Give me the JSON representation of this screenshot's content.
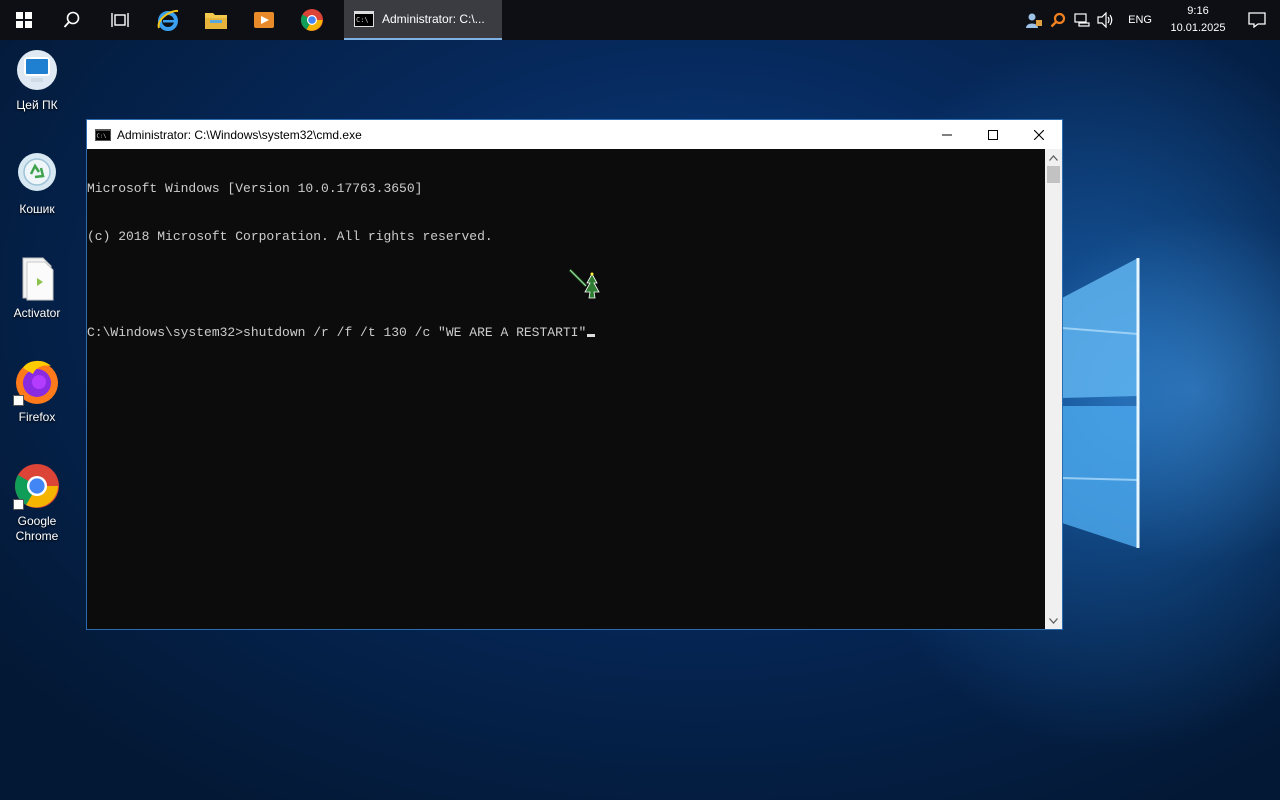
{
  "taskbar": {
    "start_icon": "windows-logo-icon",
    "pinned": [
      {
        "name": "search-icon"
      },
      {
        "name": "task-view-icon"
      },
      {
        "name": "internet-explorer-icon"
      },
      {
        "name": "file-explorer-icon"
      },
      {
        "name": "media-player-icon"
      },
      {
        "name": "chrome-icon"
      }
    ],
    "active_app_label": "Administrator: C:\\...",
    "tray": {
      "language": "ENG",
      "time": "9:16",
      "date": "10.01.2025"
    }
  },
  "desktop": {
    "icons": [
      {
        "label": "Цей ПК",
        "icon": "computer-icon"
      },
      {
        "label": "Кошик",
        "icon": "recycle-bin-icon"
      },
      {
        "label": "Activator",
        "icon": "file-icon"
      },
      {
        "label": "Firefox",
        "icon": "firefox-icon"
      },
      {
        "label": "Google Chrome",
        "icon": "chrome-icon"
      }
    ]
  },
  "cmd": {
    "title": "Administrator: C:\\Windows\\system32\\cmd.exe",
    "lines": [
      "Microsoft Windows [Version 10.0.17763.3650]",
      "(c) 2018 Microsoft Corporation. All rights reserved.",
      "",
      "C:\\Windows\\system32>shutdown /r /f /t 130 /c \"WE ARE A RESTARTI\""
    ]
  },
  "colors": {
    "taskbar_bg": "#0d0f14",
    "console_bg": "#0c0c0c",
    "console_text": "#cccccc",
    "accent": "#7fb3e6"
  }
}
